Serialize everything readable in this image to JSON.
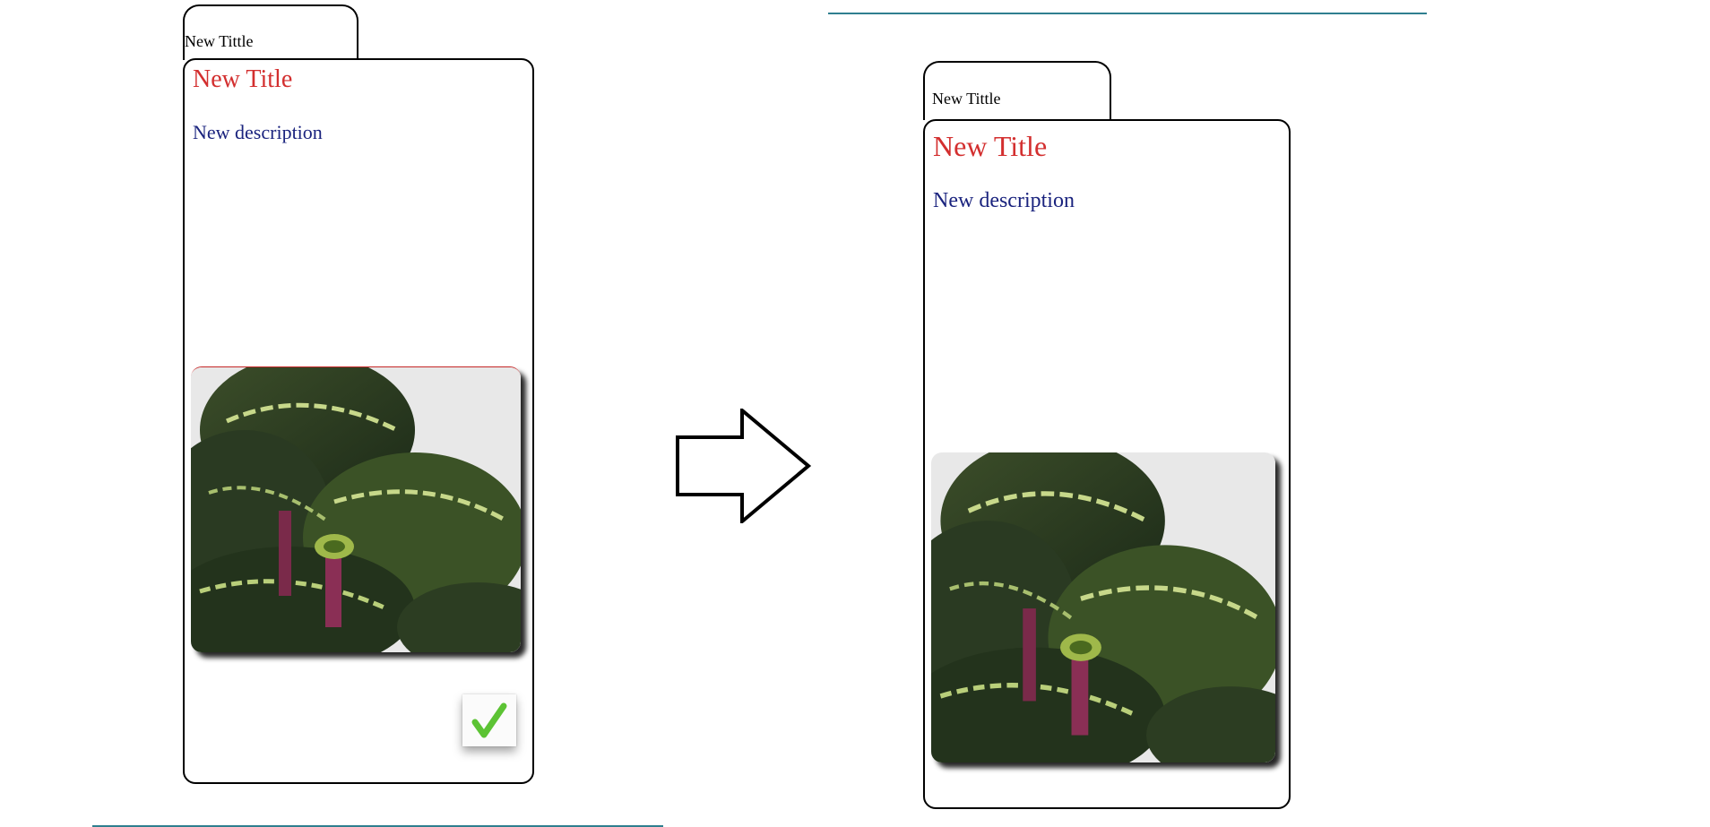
{
  "colors": {
    "title": "#d32f2f",
    "description": "#1a237e",
    "rule": "#2f7f8f",
    "check": "#5cc334"
  },
  "before": {
    "tab_label": "New Tittle",
    "title": "New Title",
    "description": "New description",
    "image_alt": "calathea-plant-photo",
    "confirm_icon": "checkmark-icon"
  },
  "after": {
    "tab_label": "New Tittle",
    "title": "New Title",
    "description": "New description",
    "image_alt": "calathea-plant-photo"
  },
  "transition_icon": "right-arrow-icon"
}
